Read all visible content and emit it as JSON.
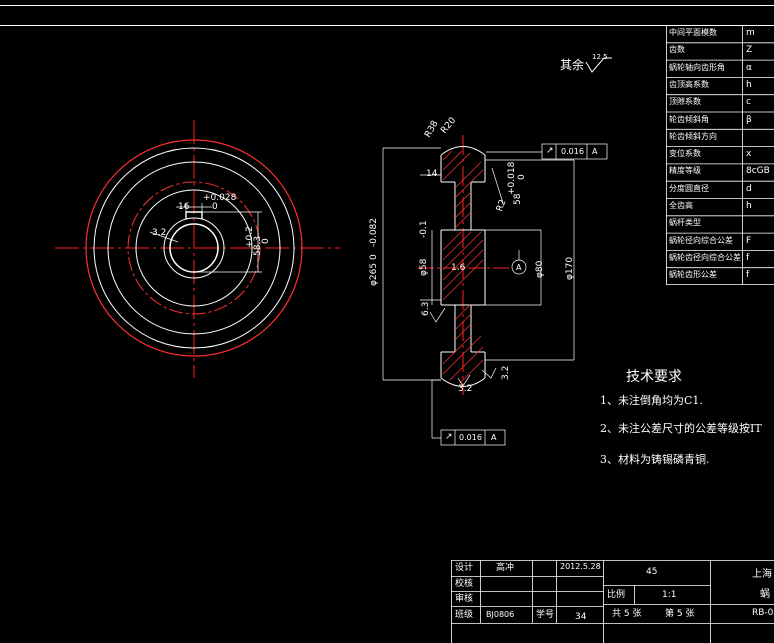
{
  "colors": {
    "background": "#000000",
    "line": "#ffffff",
    "center_line": "#ff2020",
    "outer_circle": "#ff3030",
    "accent": "#00ffff"
  },
  "roughness": {
    "label": "其余",
    "value": "12.5"
  },
  "param_table": [
    {
      "name": "中间平面模数",
      "value": "m"
    },
    {
      "name": "齿数",
      "value": "Z"
    },
    {
      "name": "蜗轮轴向齿形角",
      "value": "α"
    },
    {
      "name": "齿顶高系数",
      "value": "h"
    },
    {
      "name": "顶隙系数",
      "value": "c"
    },
    {
      "name": "轮齿倾斜角",
      "value": "β"
    },
    {
      "name": "轮齿倾斜方向",
      "value": ""
    },
    {
      "name": "变位系数",
      "value": "x"
    },
    {
      "name": "精度等级",
      "value": "8cGB"
    },
    {
      "name": "分度圆直径",
      "value": "d"
    },
    {
      "name": "全齿高",
      "value": "h"
    },
    {
      "name": "蜗杆类型",
      "value": ""
    },
    {
      "name": "蜗轮径向综合公差",
      "value": "F"
    },
    {
      "name": "蜗轮齿径向综合公差",
      "value": "f"
    },
    {
      "name": "蜗轮齿形公差",
      "value": "f"
    }
  ],
  "tech_requirements": {
    "title": "技术要求",
    "items": [
      "1、未注倒角均为C1.",
      "2、未注公差尺寸的公差等级按IT",
      "3、材料为铸锡磷青铜."
    ]
  },
  "front_view_dims": {
    "keyway_width": "16",
    "keyway_tol": "+0.028",
    "keyway_tol_low": "0",
    "bore_depth": "58.3",
    "bore_tol": "+0.2",
    "bore_tol_low": "0",
    "small": "3.2"
  },
  "section_dims": {
    "dim_14": "14",
    "r38": "R38",
    "r20": "R20",
    "r2": "R2",
    "slot_tol": "+0.018",
    "slot_tol_low": "0",
    "slot": "58",
    "d_bore": "φ58",
    "bore_tol": "-0.1",
    "outer_diam": "φ265",
    "outer_tol": "-0.082",
    "outer_tol_low": "0",
    "d80": "φ80",
    "d170": "φ170",
    "chamfer": "1.6",
    "r63": "6.3",
    "r32a": "3.2",
    "r32b": "3.2",
    "datum": "A",
    "geo_tol_1": "0.016",
    "geo_tol_datum_1": "A",
    "geo_tol_2": "0.016",
    "geo_tol_datum_2": "A",
    "runout_symbol": "↗"
  },
  "title_block": {
    "design_label": "设计",
    "designer": "高冲",
    "date": "2012.5.28",
    "check_label": "校核",
    "review_label": "审核",
    "class_label": "班级",
    "class_value": "BJ0806",
    "student_no_label": "学号",
    "student_no_value": "34",
    "material": "45",
    "scale_label": "比例",
    "scale_value": "1:1",
    "sheets": "共 5 张",
    "sheet_no": "第 5 张",
    "school": "上海",
    "part_name": "蜗",
    "drawing_no": "RB-0"
  }
}
